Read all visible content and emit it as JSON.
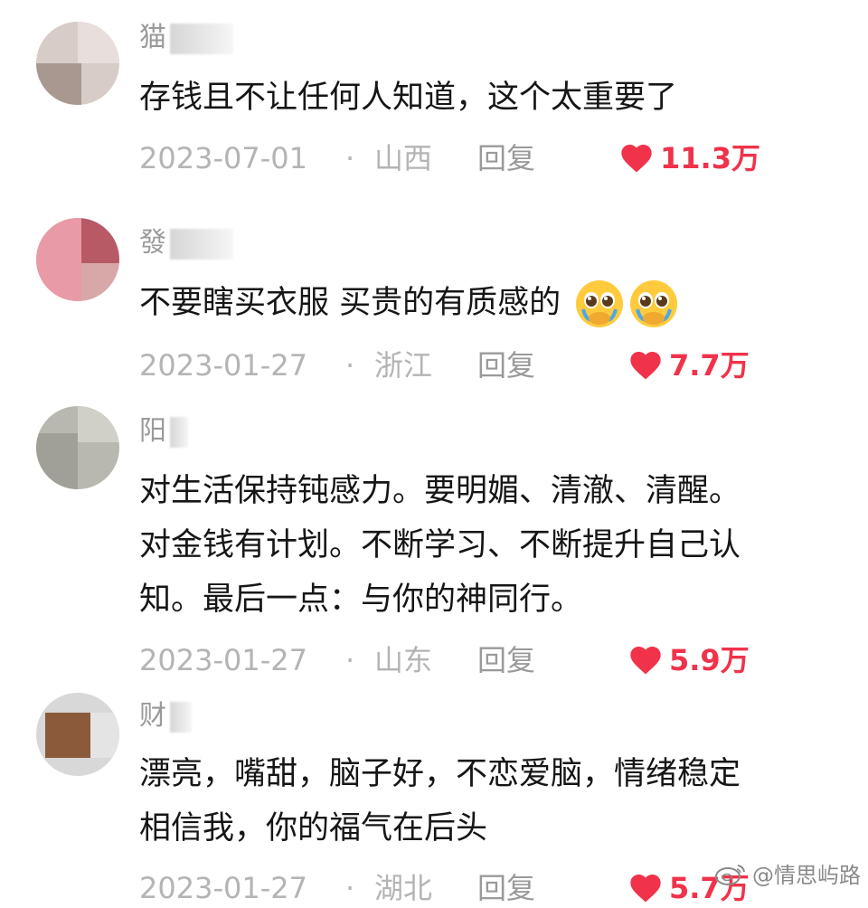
{
  "comments": [
    {
      "username": "猫",
      "text": "存钱且不让任何人知道，这个太重要了",
      "date": "2023-07-01",
      "separator": "·",
      "location": "山西",
      "reply_label": "回复",
      "likes": "11.3万",
      "avatar_colors": [
        "#c8bcb8",
        "#a89890",
        "#e6dcd8"
      ]
    },
    {
      "username": "發",
      "text": "不要瞎买衣服  买贵的有质感的",
      "date": "2023-01-27",
      "separator": "·",
      "location": "浙江",
      "reply_label": "回复",
      "likes": "7.7万",
      "avatar_colors": [
        "#e89aa6",
        "#b85a66",
        "#f2c6cc"
      ]
    },
    {
      "username": "阳",
      "text_lines": [
        "对生活保持钝感力。要明媚、清澈、清醒。",
        "对金钱有计划。不断学习、不断提升自己认",
        "知。最后一点：与你的神同行。"
      ],
      "date": "2023-01-27",
      "separator": "·",
      "location": "山东",
      "reply_label": "回复",
      "likes": "5.9万",
      "avatar_colors": [
        "#a8a8a0",
        "#c8c8c0",
        "#8c8c84"
      ]
    },
    {
      "username": "财",
      "text_lines": [
        "漂亮，嘴甜，脑子好，不恋爱脑，情绪稳定",
        "相信我，你的福气在后头"
      ],
      "date": "2023-01-27",
      "separator": "·",
      "location": "湖北",
      "reply_label": "回复",
      "likes": "5.7万",
      "avatar_colors": [
        "#8a5a3a",
        "#c8c8c8",
        "#a08070"
      ]
    }
  ],
  "colors": {
    "accent_like": "#f0324a",
    "meta_gray": "#b4b4b4",
    "text": "#161616"
  },
  "icons": {
    "like": "heart-icon",
    "emoji": "pleading-face-emoji-icon"
  },
  "watermark": {
    "text": "@情思屿路",
    "icon": "weibo-icon"
  }
}
